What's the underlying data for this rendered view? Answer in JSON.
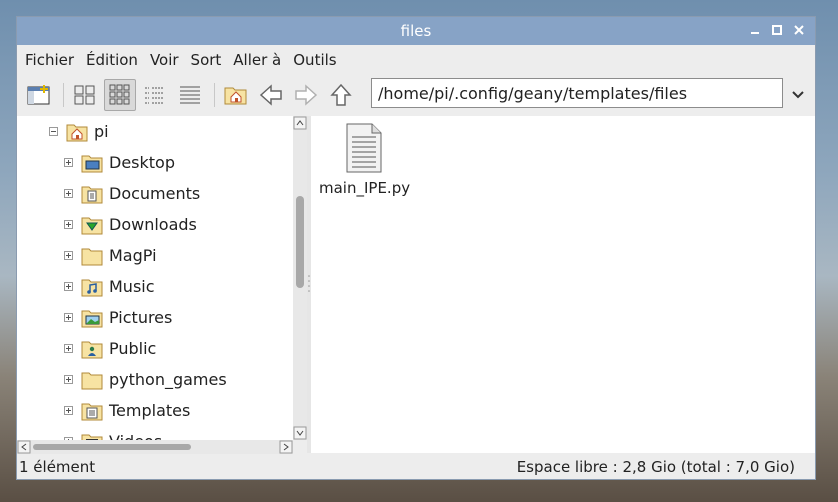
{
  "window": {
    "title": "files"
  },
  "menu": [
    "Fichier",
    "Édition",
    "Voir",
    "Sort",
    "Aller à",
    "Outils"
  ],
  "toolbar": {
    "path": "/home/pi/.config/geany/templates/files"
  },
  "tree": {
    "root": "pi",
    "items": [
      "Desktop",
      "Documents",
      "Downloads",
      "MagPi",
      "Music",
      "Pictures",
      "Public",
      "python_games",
      "Templates",
      "Videos"
    ]
  },
  "files": [
    {
      "name": "main_IPE.py",
      "icon": "text-file-icon"
    }
  ],
  "status": {
    "count": "1 élément",
    "free_space": "Espace libre : 2,8 Gio (total : 7,0 Gio)"
  }
}
